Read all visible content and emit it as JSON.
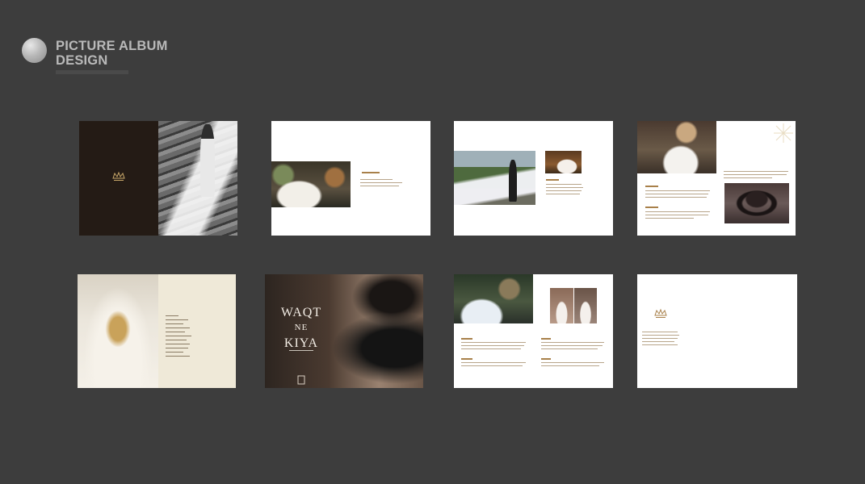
{
  "header": {
    "title_line1": "PICTURE ALBUM",
    "title_line2": "DESIGN"
  },
  "pages": [
    {
      "id": 1,
      "theme": "dark-cover-with-bw-photo"
    },
    {
      "id": 2,
      "theme": "white-with-single-photo"
    },
    {
      "id": 3,
      "theme": "white-with-two-photos"
    },
    {
      "id": 4,
      "theme": "white-with-photos-and-ornament"
    },
    {
      "id": 5,
      "theme": "beige-dress-detail"
    },
    {
      "id": 6,
      "theme": "dark-title-cover"
    },
    {
      "id": 7,
      "theme": "white-with-three-photos"
    },
    {
      "id": 8,
      "theme": "white-logo-page"
    }
  ],
  "cover": {
    "title_line1": "WAQT",
    "title_line2": "NE",
    "title_line3": "KIYA"
  },
  "colors": {
    "background": "#3d3d3d",
    "accent": "#a8804a",
    "dark_page": "#231a14",
    "beige_page": "#efe9d8"
  }
}
